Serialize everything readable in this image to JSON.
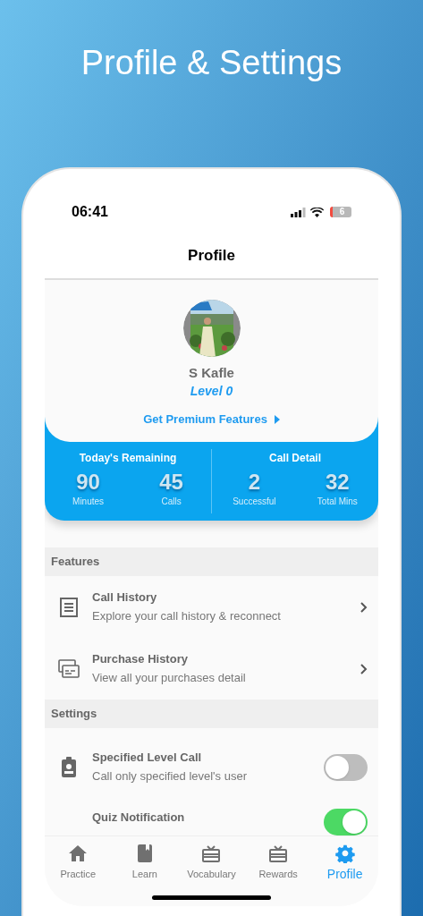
{
  "headline": "Profile & Settings",
  "status_bar": {
    "time": "06:41",
    "battery": "6"
  },
  "header": {
    "title": "Profile"
  },
  "profile": {
    "name": "S Kafle",
    "level": "Level 0",
    "premium_link": "Get Premium Features"
  },
  "stats": [
    {
      "title": "Today's Remaining",
      "items": [
        {
          "value": "90",
          "label": "Minutes"
        },
        {
          "value": "45",
          "label": "Calls"
        }
      ]
    },
    {
      "title": "Call Detail",
      "items": [
        {
          "value": "2",
          "label": "Successful"
        },
        {
          "value": "32",
          "label": "Total Mins"
        }
      ]
    }
  ],
  "sections": [
    {
      "title": "Features",
      "rows": [
        {
          "kind": "link",
          "title": "Call History",
          "subtitle": "Explore your call history & reconnect"
        },
        {
          "kind": "link",
          "title": "Purchase History",
          "subtitle": "View all your purchases detail"
        }
      ]
    },
    {
      "title": "Settings",
      "rows": [
        {
          "kind": "toggle",
          "title": "Specified Level Call",
          "subtitle": "Call only specified level's user",
          "on": false
        },
        {
          "kind": "toggle",
          "title": "Quiz Notification",
          "on": true
        }
      ]
    }
  ],
  "tabs": [
    {
      "label": "Practice",
      "selected": false
    },
    {
      "label": "Learn",
      "selected": false
    },
    {
      "label": "Vocabulary",
      "selected": false
    },
    {
      "label": "Rewards",
      "selected": false
    },
    {
      "label": "Profile",
      "selected": true
    }
  ]
}
